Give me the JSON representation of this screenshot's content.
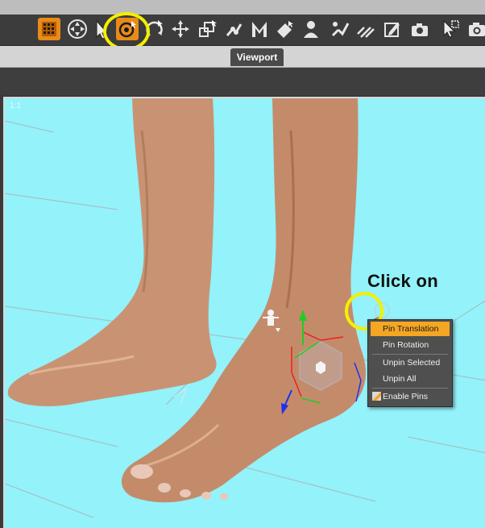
{
  "viewport_tab": {
    "label": "Viewport"
  },
  "viewport": {
    "corner_label": "1:1"
  },
  "annotation": {
    "text": "Click on"
  },
  "context_menu": {
    "items": [
      {
        "label": "Pin Translation"
      },
      {
        "label": "Pin Rotation"
      },
      {
        "label": "Unpin Selected"
      },
      {
        "label": "Unpin All"
      },
      {
        "label": "Enable Pins"
      }
    ]
  },
  "colors": {
    "accent": "#f5a623",
    "highlight_circle": "#f4ef00",
    "viewport_bg": "#93f2fa"
  },
  "toolbar": {
    "icons": [
      "grid-icon",
      "universal-tool-icon",
      "node-selection-icon",
      "active-pose-tool-icon",
      "rotate-tool-icon",
      "translate-tool-icon",
      "scale-tool-icon",
      "joint-editor-icon",
      "morph-brush-icon",
      "surface-selection-icon",
      "figure-setup-icon",
      "region-navigator-icon",
      "geometry-editor-icon",
      "edit-icon",
      "render-icon",
      "spot-render-icon",
      "camera-icon"
    ]
  }
}
